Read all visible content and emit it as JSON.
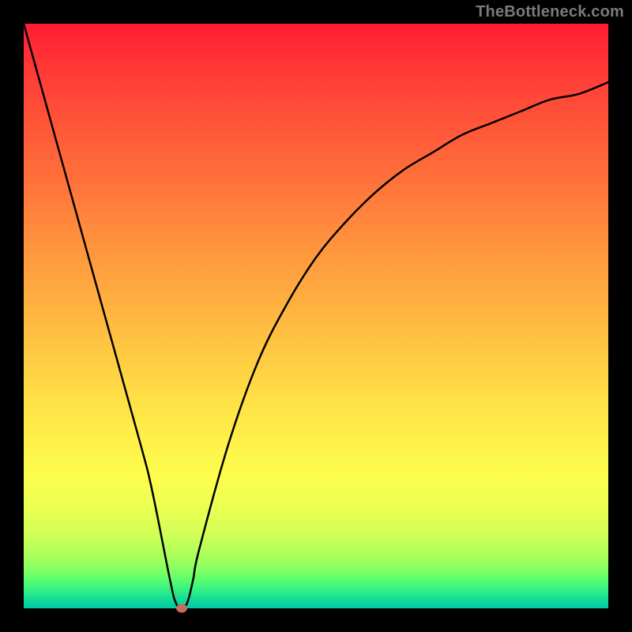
{
  "attribution": "TheBottleneck.com",
  "colors": {
    "frame": "#000000",
    "curve": "#000000",
    "marker": "#c96a5e"
  },
  "chart_data": {
    "type": "line",
    "title": "",
    "xlabel": "",
    "ylabel": "",
    "xlim": [
      0,
      100
    ],
    "ylim": [
      0,
      100
    ],
    "grid": false,
    "legend": false,
    "series": [
      {
        "name": "bottleneck-curve",
        "x": [
          0,
          5,
          10,
          15,
          20,
          22,
          25,
          26,
          27,
          28,
          29,
          30,
          35,
          40,
          45,
          50,
          55,
          60,
          65,
          70,
          75,
          80,
          85,
          90,
          95,
          100
        ],
        "y": [
          100,
          82,
          64,
          46,
          28,
          20,
          5,
          1,
          0,
          1,
          5,
          10,
          28,
          42,
          52,
          60,
          66,
          71,
          75,
          78,
          81,
          83,
          85,
          87,
          88,
          90
        ]
      }
    ],
    "marker": {
      "x": 27,
      "y": 0
    },
    "gradient_stops": [
      {
        "pct": 0,
        "color": "#ff1d34"
      },
      {
        "pct": 10,
        "color": "#ff4037"
      },
      {
        "pct": 25,
        "color": "#ff6c3a"
      },
      {
        "pct": 40,
        "color": "#ff9a3e"
      },
      {
        "pct": 55,
        "color": "#ffc542"
      },
      {
        "pct": 65,
        "color": "#ffe246"
      },
      {
        "pct": 72,
        "color": "#fff24a"
      },
      {
        "pct": 78,
        "color": "#fbff4e"
      },
      {
        "pct": 83,
        "color": "#eaff52"
      },
      {
        "pct": 87,
        "color": "#d3ff56"
      },
      {
        "pct": 90,
        "color": "#b5ff5a"
      },
      {
        "pct": 93,
        "color": "#8cff5e"
      },
      {
        "pct": 95,
        "color": "#5dff6e"
      },
      {
        "pct": 97,
        "color": "#31ef85"
      },
      {
        "pct": 98.5,
        "color": "#11db98"
      },
      {
        "pct": 100,
        "color": "#02c9a6"
      }
    ]
  }
}
